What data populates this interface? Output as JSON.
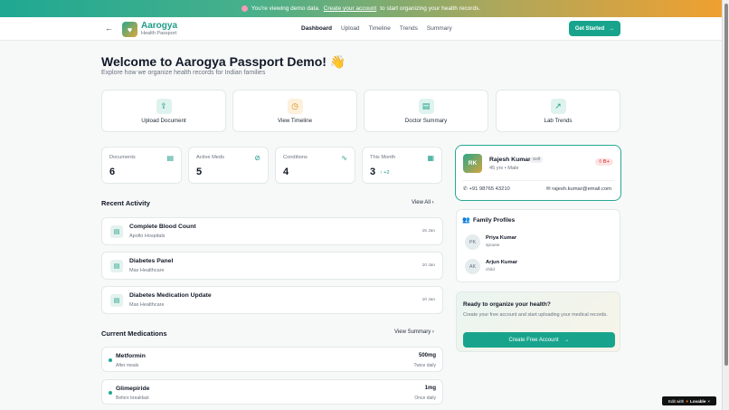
{
  "banner": {
    "prefix": "You're viewing demo data.",
    "link": "Create your account",
    "suffix": "to start organizing your health records."
  },
  "nav": {
    "back_icon": "arrow-left-icon",
    "brand_name": "Aarogya",
    "brand_sub": "Health Passport",
    "links": [
      "Dashboard",
      "Upload",
      "Timeline",
      "Trends",
      "Summary"
    ],
    "active": "Dashboard",
    "cta": "Get Started"
  },
  "page": {
    "title": "Welcome to Aarogya Passport Demo! 👋",
    "subtitle": "Explore how we organize health records for Indian families"
  },
  "actions": [
    {
      "label": "Upload Document",
      "icon": "upload-icon"
    },
    {
      "label": "View Timeline",
      "icon": "clock-icon"
    },
    {
      "label": "Doctor Summary",
      "icon": "document-icon"
    },
    {
      "label": "Lab Trends",
      "icon": "trend-up-icon"
    }
  ],
  "stats": [
    {
      "label": "Documents",
      "value": "6",
      "icon": "file-icon"
    },
    {
      "label": "Active Meds",
      "value": "5",
      "icon": "pill-icon"
    },
    {
      "label": "Conditions",
      "value": "4",
      "icon": "pulse-icon"
    },
    {
      "label": "This Month",
      "value": "3",
      "extra": "↑ +2",
      "icon": "calendar-icon"
    }
  ],
  "profile": {
    "initials": "RK",
    "name": "Rajesh Kumar",
    "badge": "Self",
    "meta": "45 yrs • Male",
    "blood_group": "B+",
    "phone": "+91 98765 43210",
    "email": "rajesh.kumar@email.com"
  },
  "family": {
    "title": "Family Profiles",
    "members": [
      {
        "initials": "PK",
        "name": "Priya Kumar",
        "relation": "spouse"
      },
      {
        "initials": "AK",
        "name": "Arjun Kumar",
        "relation": "child"
      }
    ]
  },
  "cta": {
    "title": "Ready to organize your health?",
    "text": "Create your free account and start uploading your medical records.",
    "button": "Create Free Account"
  },
  "recent": {
    "title": "Recent Activity",
    "link": "View All",
    "items": [
      {
        "title": "Complete Blood Count",
        "sub": "Apollo Hospitals",
        "date": "15 Jan"
      },
      {
        "title": "Diabetes Panel",
        "sub": "Max Healthcare",
        "date": "10 Jan"
      },
      {
        "title": "Diabetes Medication Update",
        "sub": "Max Healthcare",
        "date": "10 Jan"
      }
    ]
  },
  "meds": {
    "title": "Current Medications",
    "link": "View Summary",
    "items": [
      {
        "name": "Metformin",
        "note": "After meals",
        "dose": "500mg",
        "freq": "Twice daily"
      },
      {
        "name": "Glimepiride",
        "note": "Before breakfast",
        "dose": "1mg",
        "freq": "Once daily"
      }
    ]
  },
  "lovable": {
    "prefix": "Edit with",
    "brand": "Lovable"
  },
  "colors": {
    "accent": "#18a48c",
    "brand_orange": "#f0a030"
  }
}
